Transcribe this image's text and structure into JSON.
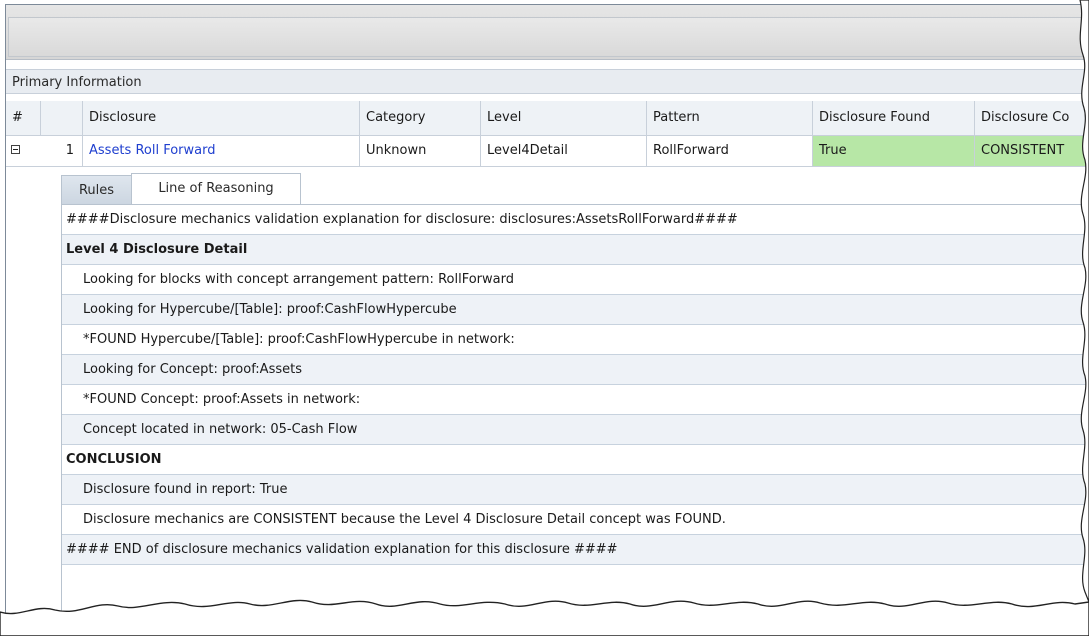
{
  "section": {
    "title": "Primary Information"
  },
  "grid": {
    "columns": [
      "#",
      "Disclosure",
      "Category",
      "Level",
      "Pattern",
      "Disclosure Found",
      "Disclosure Co"
    ],
    "rows": [
      {
        "num": "1",
        "disclosure": "Assets Roll Forward",
        "category": "Unknown",
        "level": "Level4Detail",
        "pattern": "RollForward",
        "found": "True",
        "consistency": "CONSISTENT"
      }
    ],
    "highlight_color": "#b7e7a6"
  },
  "tabs": [
    {
      "label": "Rules",
      "active": false
    },
    {
      "label": "Line of Reasoning",
      "active": true
    }
  ],
  "reasoning": [
    "####Disclosure mechanics validation explanation for disclosure: disclosures:AssetsRollForward####",
    "Level 4 Disclosure Detail",
    "Looking for blocks with concept arrangement pattern: RollForward",
    "Looking for Hypercube/[Table]: proof:CashFlowHypercube",
    "*FOUND Hypercube/[Table]: proof:CashFlowHypercube in network:",
    "Looking for Concept: proof:Assets",
    "*FOUND Concept: proof:Assets in network:",
    "Concept located in network: 05-Cash Flow",
    "CONCLUSION",
    "Disclosure found in report: True",
    "Disclosure mechanics are CONSISTENT because the Level 4 Disclosure Detail concept was FOUND.",
    "#### END of disclosure mechanics validation explanation for this disclosure ####"
  ]
}
